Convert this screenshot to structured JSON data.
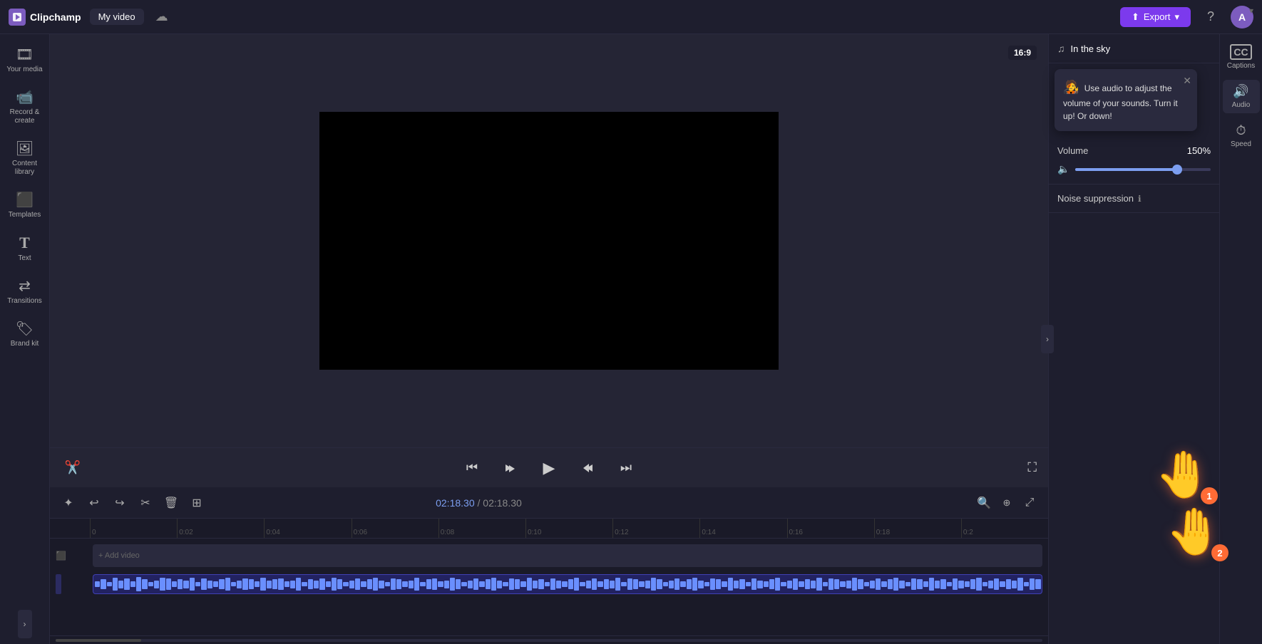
{
  "app": {
    "logo_text": "Clipchamp",
    "tab_title": "My video",
    "export_label": "Export",
    "help_title": "Help",
    "avatar_letter": "A"
  },
  "sidebar": {
    "items": [
      {
        "id": "your-media",
        "icon": "🎞",
        "label": "Your media"
      },
      {
        "id": "record-create",
        "icon": "📹",
        "label": "Record &\ncreate"
      },
      {
        "id": "content-library",
        "icon": "🖼",
        "label": "Content\nlibrary"
      },
      {
        "id": "templates",
        "icon": "⬛",
        "label": "Templates"
      },
      {
        "id": "text",
        "icon": "T",
        "label": "Text"
      },
      {
        "id": "transitions",
        "icon": "🔀",
        "label": "Transitions"
      },
      {
        "id": "brand-kit",
        "icon": "🏷",
        "label": "Brand kit"
      }
    ]
  },
  "preview": {
    "aspect_ratio": "16:9"
  },
  "playback": {
    "go_start": "⏮",
    "rewind": "↺",
    "play": "▶",
    "forward": "↻",
    "go_end": "⏭"
  },
  "timeline": {
    "current_time": "02:18.30",
    "total_time": "02:18.30",
    "separator": " / ",
    "ruler_marks": [
      "0",
      "0:02",
      "0:04",
      "0:06",
      "0:08",
      "0:10",
      "0:12",
      "0:14",
      "0:16",
      "0:18",
      "0:2"
    ],
    "add_video_label": "+ Add video"
  },
  "audio_panel": {
    "track_name": "In the sky",
    "music_icon": "♫",
    "popup_text": "Use audio to adjust the volume of your sounds. Turn it up! Or down!",
    "popup_emoji": "🧑‍🎤",
    "volume_label": "Volume",
    "volume_value": "150%",
    "noise_label": "Noise suppression",
    "volume_percent": 75
  },
  "right_icons": [
    {
      "id": "captions",
      "icon": "CC",
      "label": "Captions"
    },
    {
      "id": "audio",
      "icon": "🔊",
      "label": "Audio"
    },
    {
      "id": "speed",
      "icon": "⏱",
      "label": "Speed"
    }
  ],
  "cursors": [
    {
      "id": "cursor1",
      "badge": "1"
    },
    {
      "id": "cursor2",
      "badge": "2"
    }
  ]
}
